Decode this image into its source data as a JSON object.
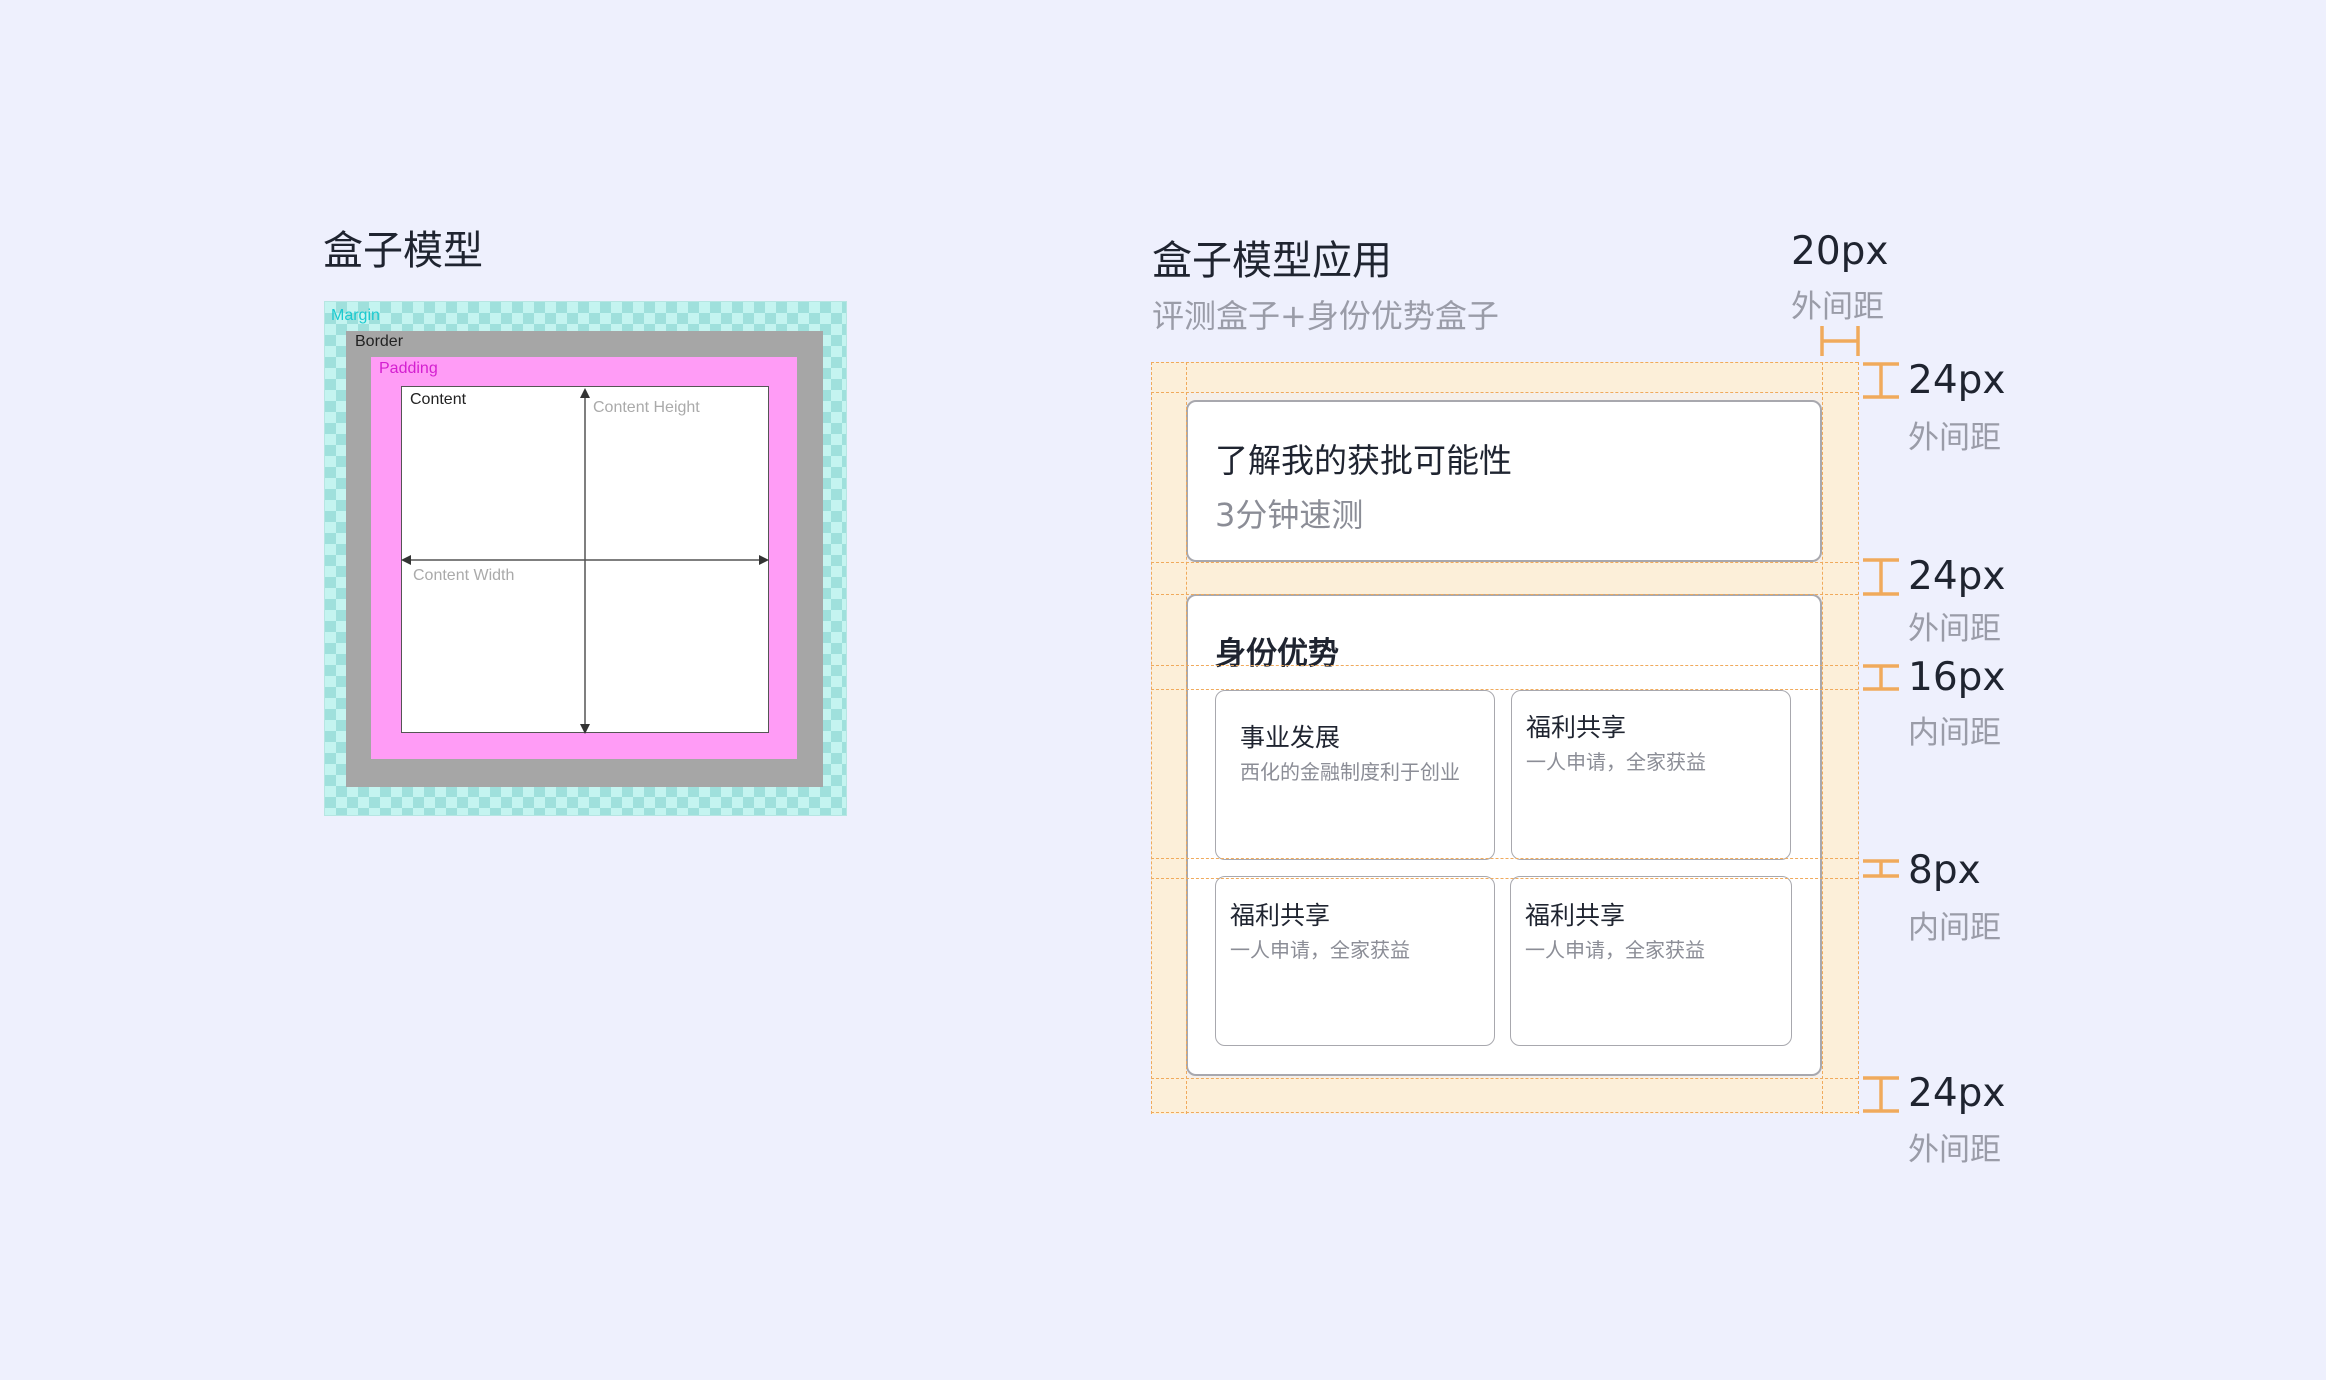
{
  "left": {
    "title": "盒子模型",
    "labels": {
      "margin": "Margin",
      "border": "Border",
      "padding": "Padding",
      "content": "Content",
      "content_height": "Content Height",
      "content_width": "Content Width"
    }
  },
  "right": {
    "title": "盒子模型应用",
    "subtitle": "评测盒子+身份优势盒子",
    "card1": {
      "title": "了解我的获批可能性",
      "subtitle": "3分钟速测"
    },
    "card2": {
      "title": "身份优势",
      "items": [
        {
          "title": "事业发展",
          "desc": "西化的金融制度利于创业"
        },
        {
          "title": "福利共享",
          "desc": "一人申请，全家获益"
        },
        {
          "title": "福利共享",
          "desc": "一人申请，全家获益"
        },
        {
          "title": "福利共享",
          "desc": "一人申请，全家获益"
        }
      ]
    },
    "dimensions": [
      {
        "value": "20px",
        "label": "外间距"
      },
      {
        "value": "24px",
        "label": "外间距"
      },
      {
        "value": "24px",
        "label": "外间距"
      },
      {
        "value": "16px",
        "label": "内间距"
      },
      {
        "value": "8px",
        "label": "内间距"
      },
      {
        "value": "24px",
        "label": "外间距"
      }
    ]
  },
  "colors": {
    "background": "#eef0fd",
    "margin": "#c4f4f0",
    "border": "#a6a6a6",
    "padding": "#ff9cf6",
    "spacing_highlight": "#fcefd9",
    "dimension_marker": "#f0aa5c"
  }
}
